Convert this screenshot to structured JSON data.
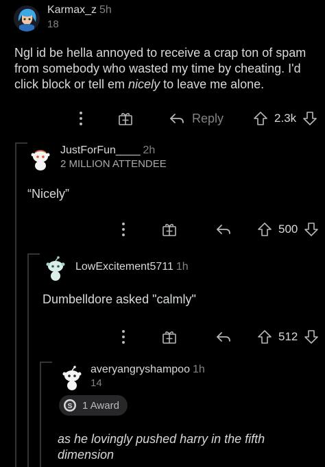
{
  "comments": [
    {
      "username": "Karmax_z",
      "time": "5h",
      "score_line": "18",
      "body_before": "Ngl id be hella annoyed to receive a crap ton of spam from somebody who wasted my time by cheating. I'd click block or tell em ",
      "body_em": "nicely",
      "body_after": " to leave me alone.",
      "reply_label": "Reply",
      "votes": "2.3k"
    },
    {
      "username": "JustForFun____",
      "time": "2h",
      "flair": "2 MILLION ATTENDEE",
      "body": "“Nicely”",
      "votes": "500"
    },
    {
      "username": "LowExcitement5711",
      "time": "1h",
      "body": "Dumbelldore asked \"calmly\"",
      "votes": "512"
    },
    {
      "username": "averyangryshampoo",
      "time": "1h",
      "score_line": "14",
      "award": "1 Award",
      "body": "as he lovingly pushed harry in the fifth dimension"
    }
  ],
  "colors": {
    "background": "#000000",
    "text": "#d7dadc",
    "muted": "#818384",
    "thread_line": "#343536"
  }
}
